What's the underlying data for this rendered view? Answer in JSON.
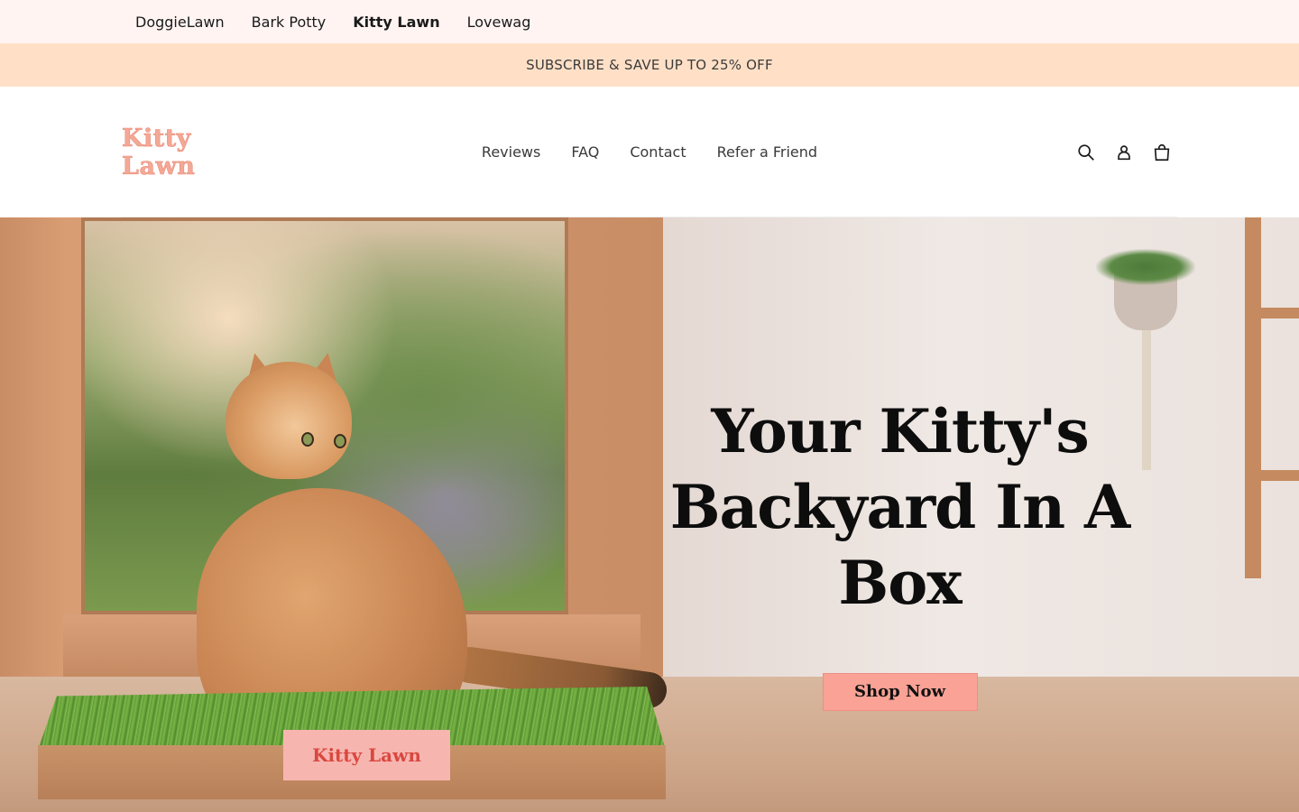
{
  "brand_bar": {
    "items": [
      {
        "label": "DoggieLawn",
        "active": false
      },
      {
        "label": "Bark Potty",
        "active": false
      },
      {
        "label": "Kitty Lawn",
        "active": true
      },
      {
        "label": "Lovewag",
        "active": false
      }
    ]
  },
  "announcement": {
    "text": "SUBSCRIBE & SAVE UP TO 25% OFF"
  },
  "header": {
    "logo": "Kitty Lawn",
    "nav": [
      {
        "label": "Reviews"
      },
      {
        "label": "FAQ"
      },
      {
        "label": "Contact"
      },
      {
        "label": "Refer a Friend"
      }
    ],
    "icons": [
      "search-icon",
      "account-icon",
      "cart-icon"
    ]
  },
  "hero": {
    "title": "Your Kitty's Backyard In A Box",
    "cta_label": "Shop Now",
    "box_label": "Kitty Lawn"
  },
  "colors": {
    "brand_bar_bg": "#fff4f2",
    "announcement_bg": "#ffe0c7",
    "logo": "#f4a896",
    "cta_bg": "#f9a295"
  }
}
